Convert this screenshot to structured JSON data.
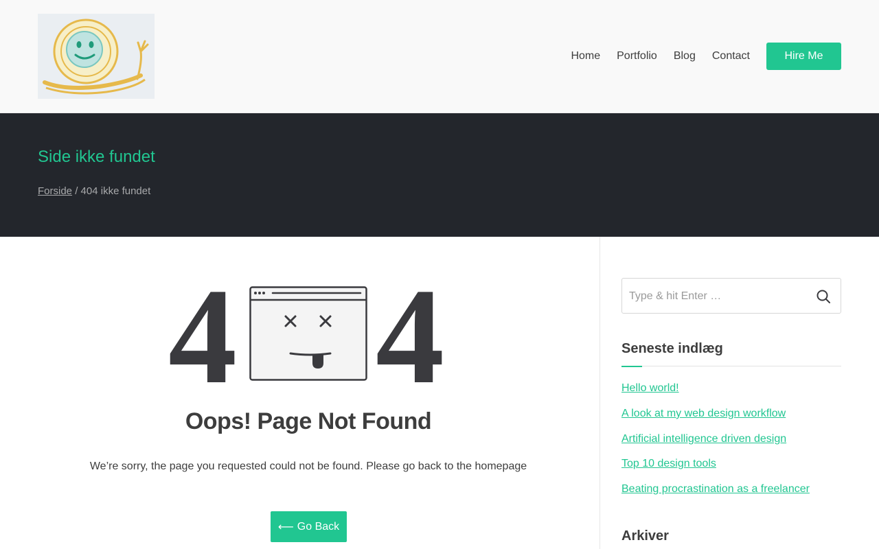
{
  "header": {
    "logo_alt": "logo",
    "nav": [
      {
        "label": "Home"
      },
      {
        "label": "Portfolio"
      },
      {
        "label": "Blog"
      },
      {
        "label": "Contact"
      }
    ],
    "hire_label": "Hire Me"
  },
  "hero": {
    "title": "Side ikke fundet",
    "breadcrumb_home": "Forside",
    "breadcrumb_sep": " / ",
    "breadcrumb_current": "404 ikke fundet"
  },
  "main": {
    "digit_left": "4",
    "digit_right": "4",
    "title": "Oops! Page Not Found",
    "message": "We’re sorry, the page you requested could not be found. Please go back to the homepage",
    "go_back_label": "Go Back",
    "go_back_icon": "arrow-left-icon"
  },
  "sidebar": {
    "search_placeholder": "Type & hit Enter …",
    "recent_title": "Seneste indlæg",
    "recent_posts": [
      "Hello world!",
      "A look at my web design workflow",
      "Artificial intelligence driven design",
      "Top 10 design tools",
      "Beating procrastination as a freelancer"
    ],
    "archives_title": "Arkiver"
  },
  "colors": {
    "accent": "#21c691",
    "hero_bg": "#23262c",
    "header_bg": "#f9f9f9",
    "text": "#3d3d3d"
  }
}
